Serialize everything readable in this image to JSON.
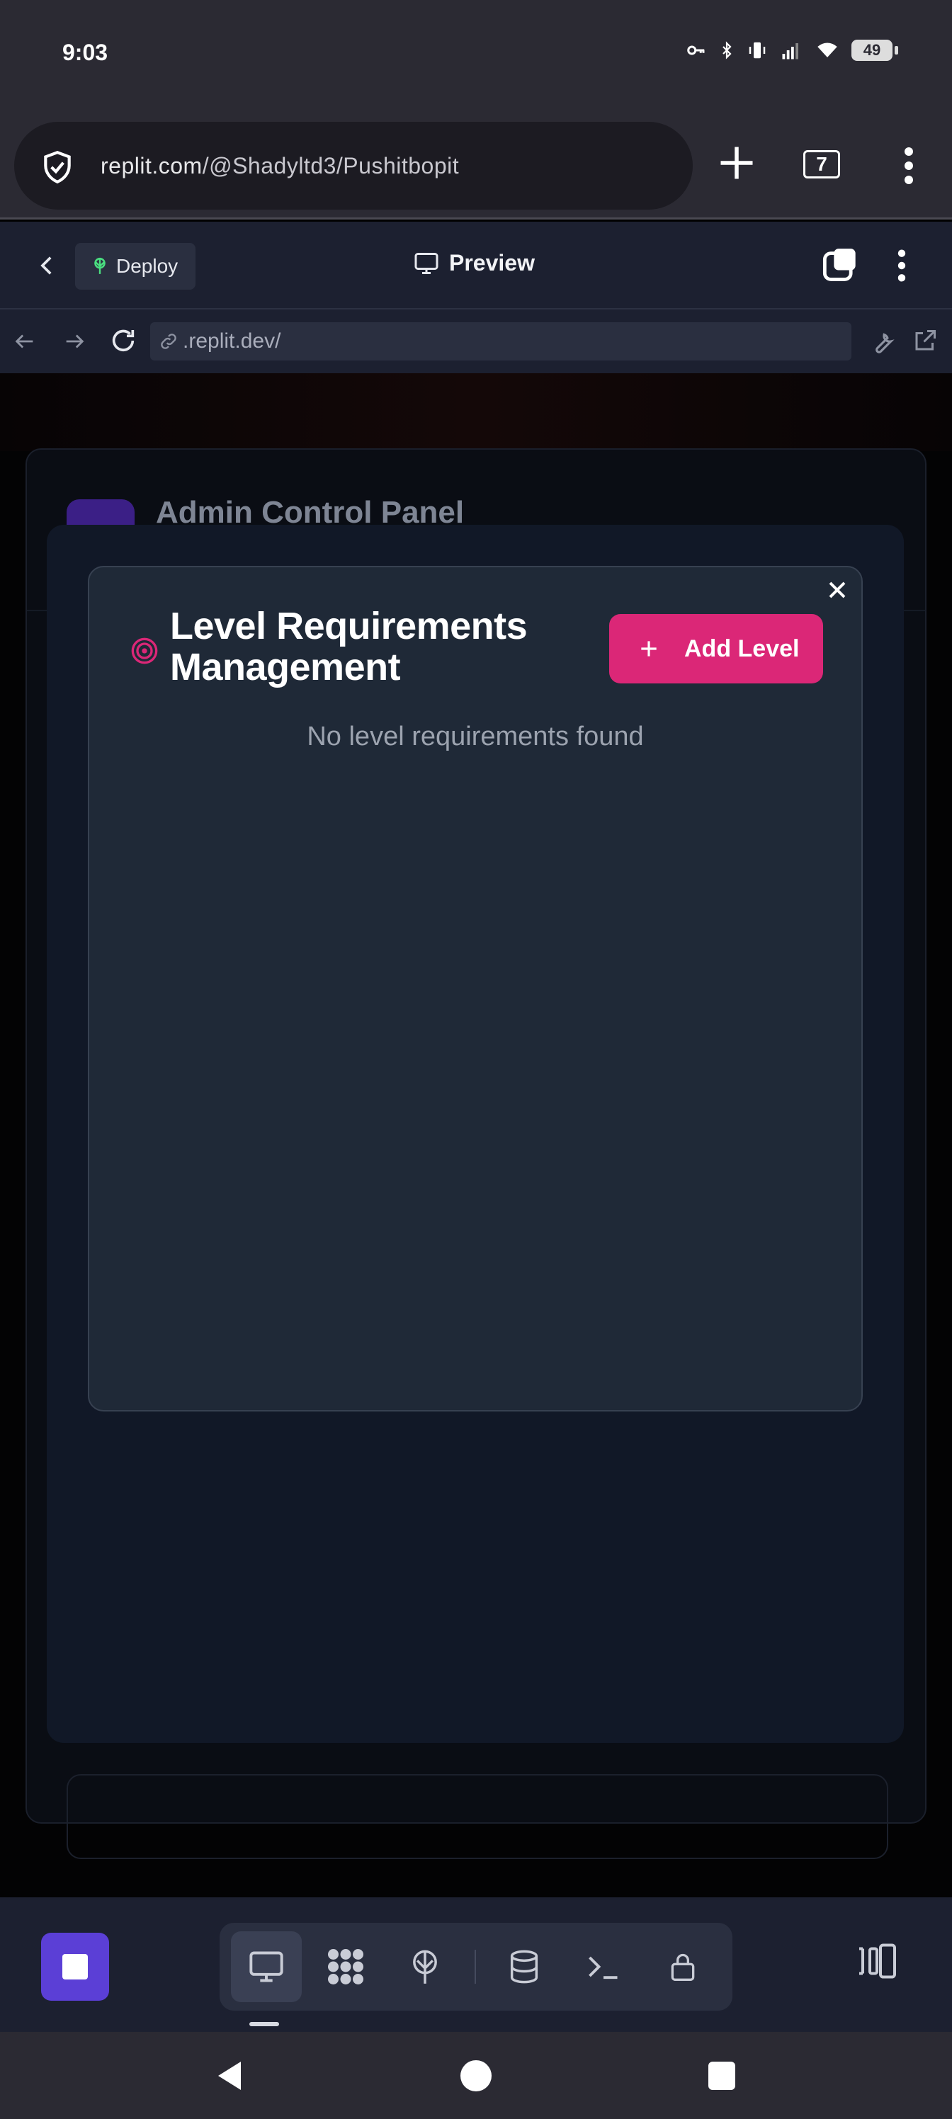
{
  "status_bar": {
    "time": "9:03",
    "battery": "49"
  },
  "browser": {
    "url_host": "replit.com",
    "url_path": "/@Shadyltd3/Pushitbopit",
    "tab_count": "7"
  },
  "replit_header": {
    "deploy_label": "Deploy",
    "preview_label": "Preview"
  },
  "address": {
    "url": ".replit.dev/"
  },
  "app": {
    "admin_title": "Admin Control Panel",
    "modal": {
      "title": "Level Requirements Management",
      "add_button_label": "Add Level",
      "empty_message": "No level requirements found"
    }
  },
  "colors": {
    "accent_pink": "#db2777",
    "run_button": "#5b3fd6",
    "deploy_icon": "#4ade80"
  },
  "icons": {
    "toolbar": [
      "monitor-icon",
      "workflow-icon",
      "deploy-icon",
      "database-icon",
      "terminal-icon",
      "lock-icon"
    ]
  }
}
